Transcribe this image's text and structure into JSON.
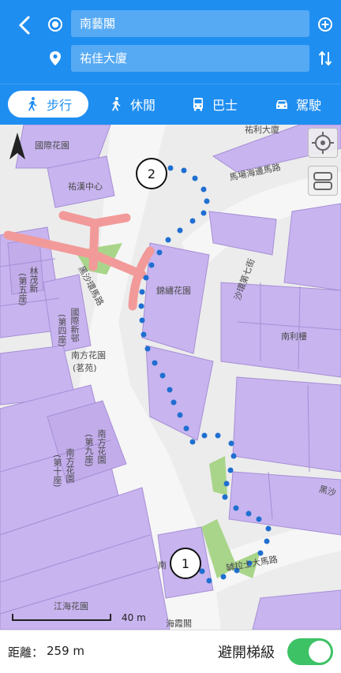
{
  "header": {
    "origin": "南藝閣",
    "destination": "祐佳大廈",
    "icons": [
      "back-icon",
      "origin-target-icon",
      "destination-pin-icon",
      "add-stop-icon",
      "swap-icon"
    ]
  },
  "tabs": [
    {
      "label": "步行",
      "icon": "walk-icon",
      "active": true
    },
    {
      "label": "休閒",
      "icon": "leisure-walk-icon",
      "active": false
    },
    {
      "label": "巴士",
      "icon": "bus-icon",
      "active": false
    },
    {
      "label": "駕駛",
      "icon": "car-icon",
      "active": false
    }
  ],
  "map": {
    "labels": {
      "guoji": "國際花園",
      "youhan": "祐漢中心",
      "jinxiu": "錦繡花園",
      "nanfang": "南方花園",
      "zhuoyuan": "(茗苑)",
      "nanli": "南利樓",
      "jianghai": "江海花園",
      "haixia": "海霞閣",
      "nan_partial": "南",
      "youjia_partial": "祐利大廈",
      "road_machang": "馬場海邊馬路",
      "road_shahuan": "沙環第七街",
      "road_heisha": "黑沙環馬路",
      "road_heisha2": "黑沙",
      "road_guanggu": "罅拉士大馬路",
      "bld_wujiang": "(第五座)",
      "bld_wujiang_name": "林茂新",
      "bld_nanfang9": "南方花園",
      "bld_nanfang9b": "(第九座)",
      "bld_nanfang10": "南方花園",
      "bld_nanfang10b": "(第十座)",
      "bld_guoji4": "國際新邨",
      "bld_guoji4b": "(第四座)"
    },
    "scale_label": "40 m",
    "marker_start": "1",
    "marker_end": "2",
    "route_color": "#1f6fd1",
    "controls": [
      "locate-icon",
      "layers-icon"
    ]
  },
  "bottom": {
    "distance_label": "距離：",
    "distance_value": "259 m",
    "avoid_stairs_label": "避開梯級",
    "avoid_stairs_on": true
  }
}
